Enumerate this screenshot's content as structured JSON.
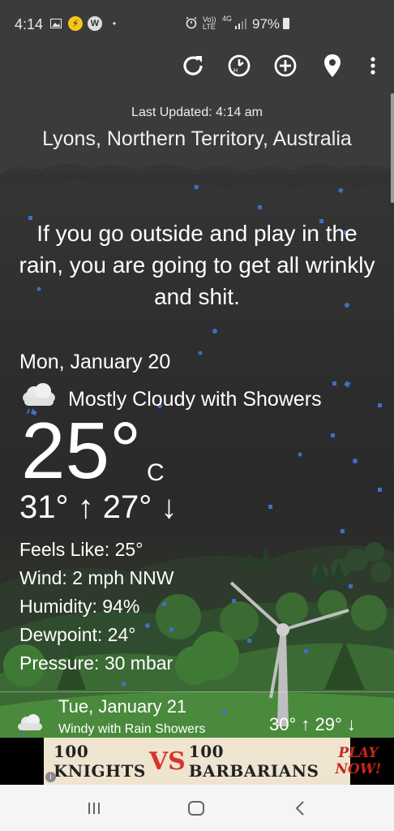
{
  "status_bar": {
    "time": "4:14",
    "volte": "Vo)) LTE",
    "network": "4G",
    "battery": "97%"
  },
  "toolbar": {
    "icons": [
      "refresh-icon",
      "history-icon",
      "add-icon",
      "location-pin-icon",
      "more-vert-icon"
    ]
  },
  "header": {
    "last_updated": "Last Updated: 4:14 am",
    "location": "Lyons, Northern Territory, Australia"
  },
  "quote": "If you go outside and play in the rain, you are going to get all wrinkly and shit.",
  "today": {
    "date": "Mon, January 20",
    "condition": "Mostly Cloudy with Showers",
    "temperature": "25°",
    "unit": "C",
    "high": "31°",
    "low": "27°",
    "feels_like": "Feels Like: 25°",
    "wind": "Wind: 2 mph NNW",
    "humidity": "Humidity: 94%",
    "dewpoint": "Dewpoint: 24°",
    "pressure": "Pressure: 30 mbar"
  },
  "tomorrow": {
    "date": "Tue, January 21",
    "condition": "Windy with Rain Showers",
    "high": "30°",
    "low": "29°"
  },
  "ad": {
    "text_1": "100 KNIGHTS",
    "vs": "VS",
    "text_2": "100 BARBARIANS",
    "cta": "PLAY NOW!",
    "info": "i"
  },
  "navbar": {
    "icons": [
      "recents-icon",
      "home-icon",
      "back-icon"
    ]
  },
  "colors": {
    "background": "#2a2a2a",
    "text": "#ffffff",
    "rain": "#3f6fc4",
    "ad_vs": "#d9342b"
  }
}
